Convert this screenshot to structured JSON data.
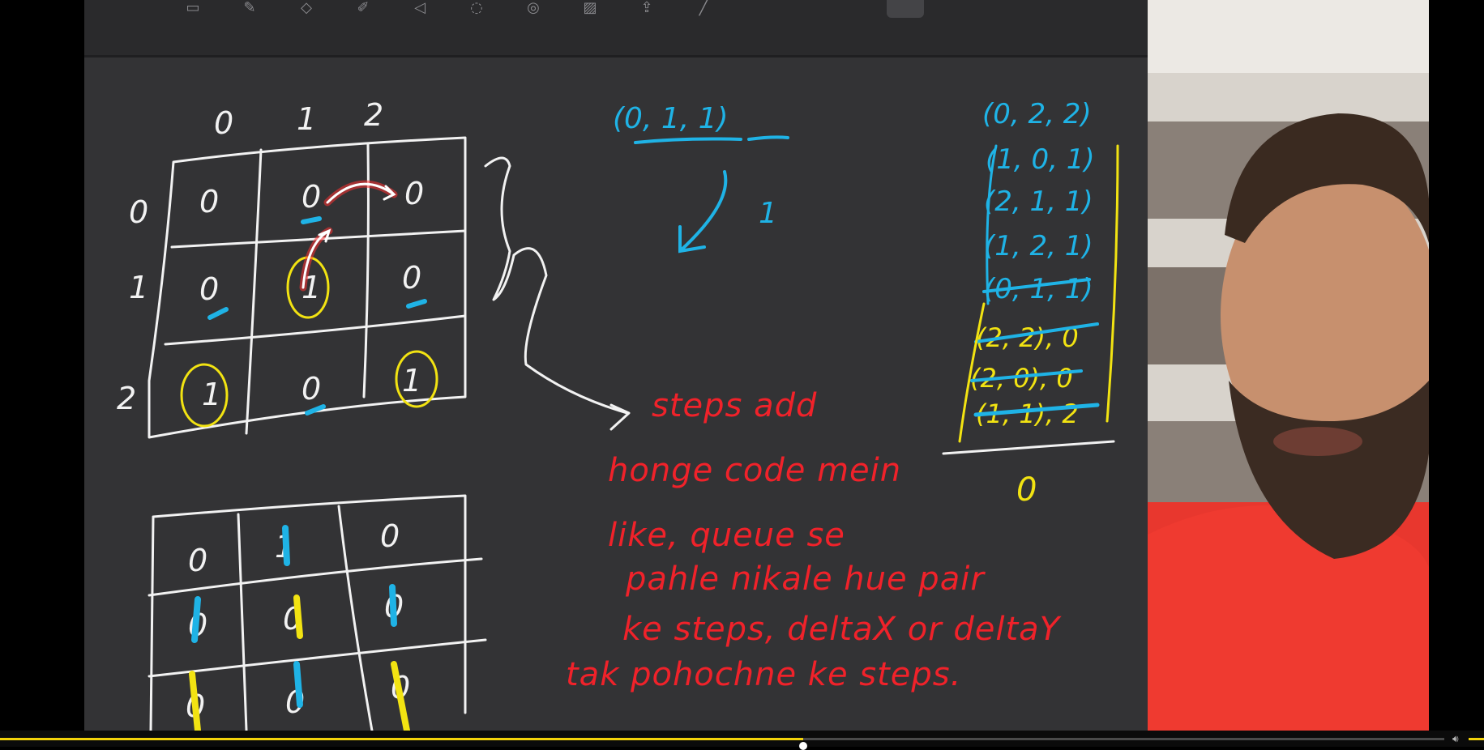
{
  "whiteboard": {
    "grid_top": {
      "col_headers": [
        "0",
        "1",
        "2"
      ],
      "row_headers": [
        "0",
        "1",
        "2"
      ],
      "cells": [
        [
          "0",
          "0",
          "0"
        ],
        [
          "0",
          "1",
          "0"
        ],
        [
          "1",
          "0",
          "1"
        ]
      ]
    },
    "grid_bottom": {
      "cells": [
        [
          "0",
          "1",
          "0"
        ],
        [
          "0",
          "0",
          "0"
        ],
        [
          "0",
          "0",
          "0"
        ]
      ]
    },
    "tuple_top": "(0, 1, 1)",
    "step_value": "1",
    "queue_header": "(0, 2, 2)",
    "queue_items": [
      "(1, 0, 1)",
      "(2, 1, 1)",
      "(1, 2, 1)",
      "(0, 1, 1)",
      "(2, 2), 0",
      "(2, 0), 0",
      "(1, 1), 2"
    ],
    "queue_result": "0",
    "note_lines": [
      "steps add",
      "honge code mein",
      "like, queue se",
      "pahle nikale hue pair",
      "ke steps, deltaX or deltaY",
      "tak pohochne ke steps."
    ]
  },
  "player": {
    "progress_fraction": 0.556
  },
  "colors": {
    "board": "#333335",
    "ink_white": "#f2f2f2",
    "ink_red": "#f0222a",
    "ink_blue": "#1fb3e6",
    "ink_yellow": "#f2e312",
    "progress": "#f2d20a"
  }
}
